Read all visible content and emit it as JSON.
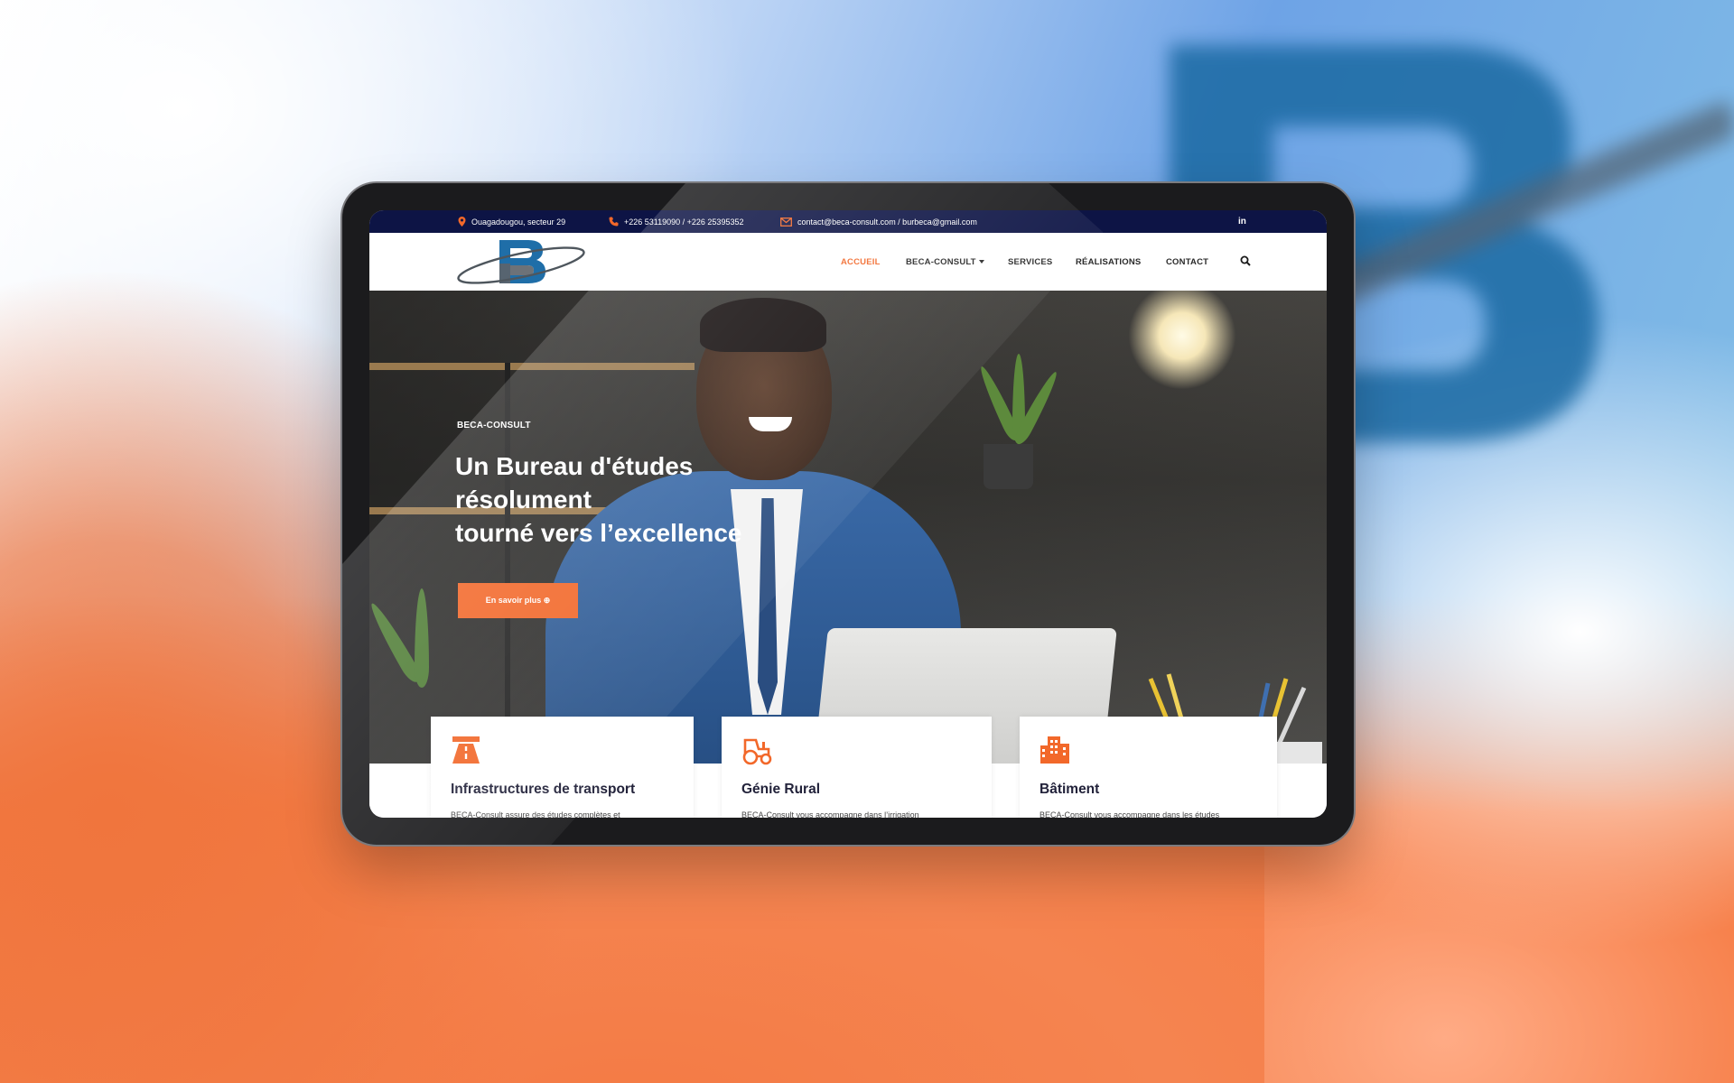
{
  "topbar": {
    "address": "Ouagadougou, secteur 29",
    "phone": "+226 53119090 / +226 25395352",
    "email": "contact@beca-consult.com / burbeca@gmail.com",
    "social_icon": "linkedin-icon"
  },
  "nav": {
    "items": [
      "ACCUEIL",
      "BECA-CONSULT",
      "SERVICES",
      "RÉALISATIONS",
      "CONTACT"
    ],
    "active": "ACCUEIL"
  },
  "hero": {
    "eyebrow": "BECA-CONSULT",
    "title_line1": "Un Bureau d'études",
    "title_line2": "résolument",
    "title_line3": "tourné vers l’excellence",
    "button_label": "En savoir plus ⊕"
  },
  "cards": [
    {
      "icon": "highway-icon",
      "title": "Infrastructures de transport",
      "text": "BECA-Consult assure des études complètes et"
    },
    {
      "icon": "tractor-icon",
      "title": "Génie Rural",
      "text": "BECA-Consult vous accompagne dans l’irrigation"
    },
    {
      "icon": "buildings-icon",
      "title": "Bâtiment",
      "text": "BECA-Consult vous accompagne dans les études"
    }
  ],
  "colors": {
    "accent": "#f2682a",
    "topbar_bg": "#0d1445",
    "brand_blue": "#1f6ea8"
  }
}
